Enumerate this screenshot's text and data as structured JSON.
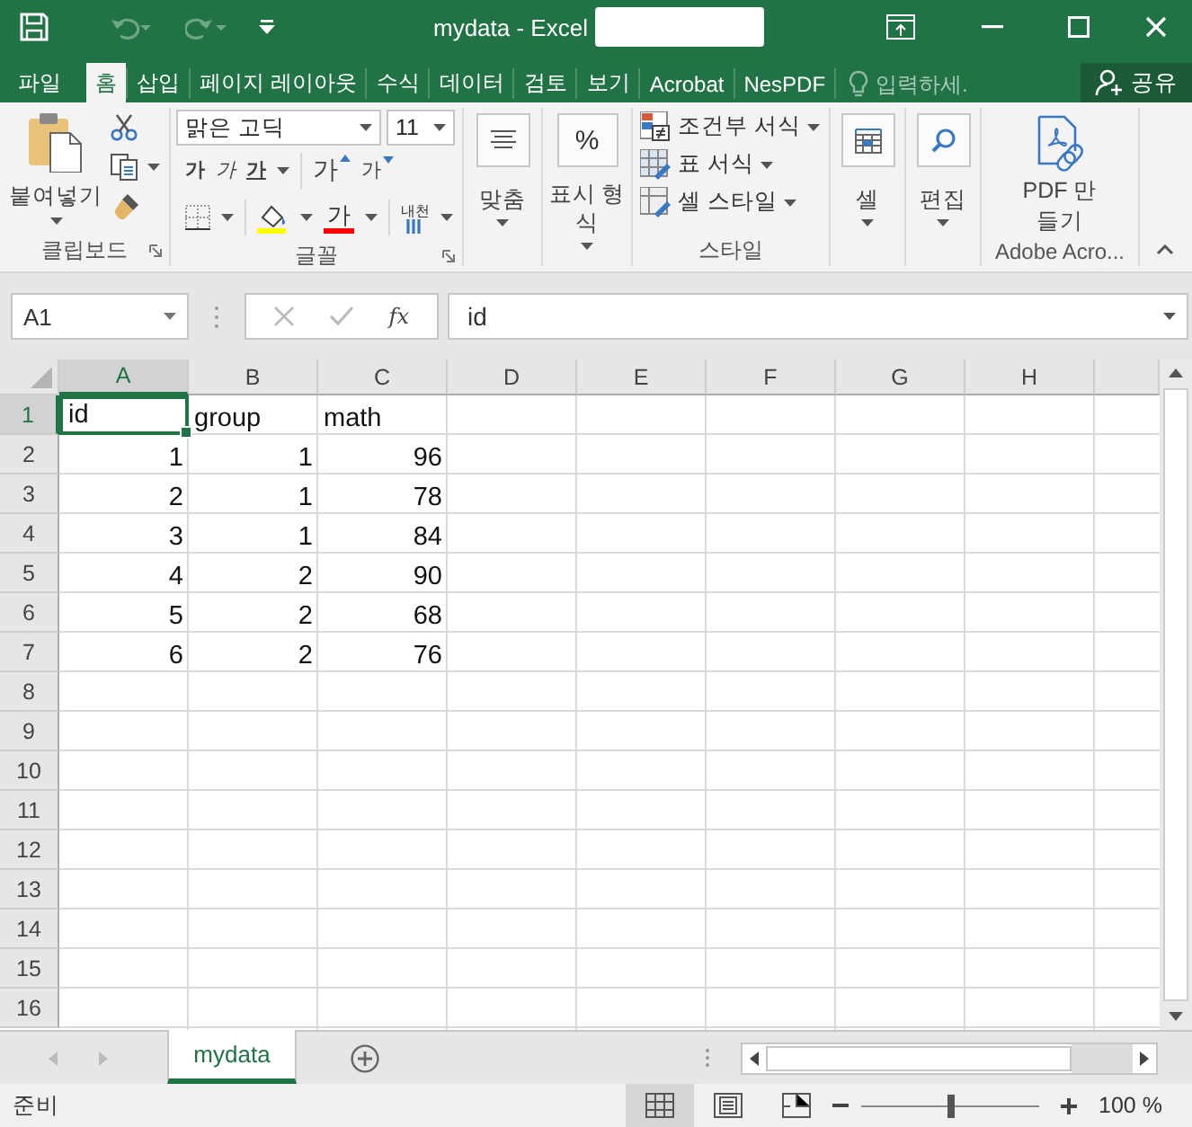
{
  "window": {
    "title": "mydata - Excel"
  },
  "menu_tabs": [
    {
      "label": "파일",
      "selected": false
    },
    {
      "label": "홈",
      "selected": true
    },
    {
      "label": "삽입",
      "selected": false
    },
    {
      "label": "페이지 레이아웃",
      "selected": false
    },
    {
      "label": "수식",
      "selected": false
    },
    {
      "label": "데이터",
      "selected": false
    },
    {
      "label": "검토",
      "selected": false
    },
    {
      "label": "보기",
      "selected": false
    },
    {
      "label": "Acrobat",
      "selected": false
    },
    {
      "label": "NesPDF",
      "selected": false
    }
  ],
  "tell_me": {
    "placeholder": "입력하세."
  },
  "share": {
    "label": "공유"
  },
  "ribbon": {
    "clipboard": {
      "title": "클립보드",
      "paste": "붙여넣기"
    },
    "font": {
      "title": "글꼴",
      "font_name": "맑은 고딕",
      "font_size": "11",
      "bold": "가",
      "italic": "가",
      "underline": "가",
      "grow": "가",
      "shrink": "가",
      "font_color": "가",
      "phonetic": "내천"
    },
    "alignment": {
      "label": "맞춤"
    },
    "number": {
      "symbol": "%",
      "label": "표시 형식"
    },
    "styles": {
      "title": "스타일",
      "items": [
        "조건부 서식",
        "표 서식",
        "셀 스타일"
      ]
    },
    "cells": {
      "label": "셀"
    },
    "editing": {
      "label": "편집"
    },
    "adobe": {
      "title": "Adobe Acro...",
      "label": "PDF 만들기"
    }
  },
  "formula_bar": {
    "name_box": "A1",
    "function_label": "fx",
    "value": "id"
  },
  "sheet": {
    "columns": [
      {
        "label": "A",
        "selected": true
      },
      {
        "label": "B",
        "selected": false
      },
      {
        "label": "C",
        "selected": false
      },
      {
        "label": "D",
        "selected": false
      },
      {
        "label": "E",
        "selected": false
      },
      {
        "label": "F",
        "selected": false
      },
      {
        "label": "G",
        "selected": false
      },
      {
        "label": "H",
        "selected": false
      }
    ],
    "rows": [
      {
        "number": "1",
        "selected": true,
        "kind": "text",
        "cells": [
          "id",
          "group",
          "math"
        ]
      },
      {
        "number": "2",
        "selected": false,
        "kind": "number",
        "cells": [
          "1",
          "1",
          "96"
        ]
      },
      {
        "number": "3",
        "selected": false,
        "kind": "number",
        "cells": [
          "2",
          "1",
          "78"
        ]
      },
      {
        "number": "4",
        "selected": false,
        "kind": "number",
        "cells": [
          "3",
          "1",
          "84"
        ]
      },
      {
        "number": "5",
        "selected": false,
        "kind": "number",
        "cells": [
          "4",
          "2",
          "90"
        ]
      },
      {
        "number": "6",
        "selected": false,
        "kind": "number",
        "cells": [
          "5",
          "2",
          "68"
        ]
      },
      {
        "number": "7",
        "selected": false,
        "kind": "number",
        "cells": [
          "6",
          "2",
          "76"
        ]
      },
      {
        "number": "8",
        "selected": false
      },
      {
        "number": "9",
        "selected": false
      },
      {
        "number": "10",
        "selected": false
      },
      {
        "number": "11",
        "selected": false
      },
      {
        "number": "12",
        "selected": false
      },
      {
        "number": "13",
        "selected": false
      },
      {
        "number": "14",
        "selected": false
      },
      {
        "number": "15",
        "selected": false
      },
      {
        "number": "16",
        "selected": false
      }
    ]
  },
  "sheet_tabs": [
    {
      "label": "mydata",
      "selected": true
    }
  ],
  "status_bar": {
    "text": "준비",
    "views": [
      {
        "kind": "normal",
        "selected": true
      },
      {
        "kind": "page_layout",
        "selected": false
      },
      {
        "kind": "page_break",
        "selected": false
      }
    ],
    "zoom": {
      "level": 0.5,
      "reading": "100 %"
    }
  }
}
